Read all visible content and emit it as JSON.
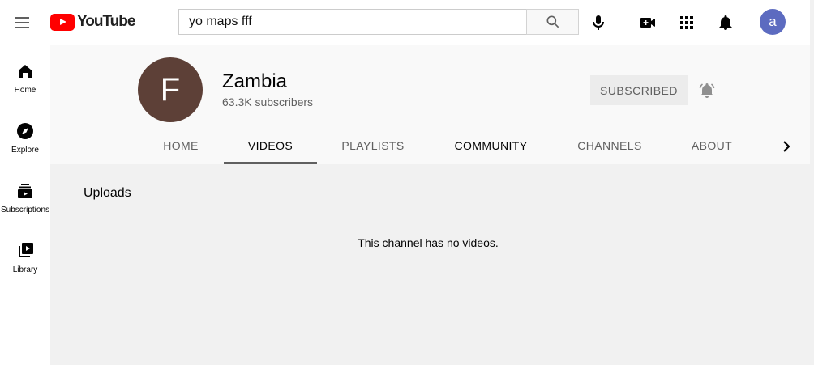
{
  "header": {
    "logo_text": "YouTube",
    "search": {
      "value": "yo maps fff"
    },
    "avatar_letter": "a",
    "colors": {
      "logo_red": "#ff0000",
      "avatar_bg": "#5c6bc0"
    }
  },
  "sidebar": {
    "items": [
      {
        "label": "Home",
        "icon": "home-icon"
      },
      {
        "label": "Explore",
        "icon": "compass-icon"
      },
      {
        "label": "Subscriptions",
        "icon": "subscriptions-icon"
      },
      {
        "label": "Library",
        "icon": "library-icon"
      }
    ]
  },
  "channel": {
    "avatar_letter": "F",
    "name": "Zambia",
    "subscribers": "63.3K subscribers",
    "subscribe_label": "SUBSCRIBED",
    "avatar_color": "#5d4037"
  },
  "tabs": [
    {
      "label": "HOME",
      "active": false
    },
    {
      "label": "VIDEOS",
      "active": true
    },
    {
      "label": "PLAYLISTS",
      "active": false
    },
    {
      "label": "COMMUNITY",
      "active": false
    },
    {
      "label": "CHANNELS",
      "active": false
    },
    {
      "label": "ABOUT",
      "active": false
    }
  ],
  "content": {
    "section_title": "Uploads",
    "empty_message": "This channel has no videos."
  }
}
